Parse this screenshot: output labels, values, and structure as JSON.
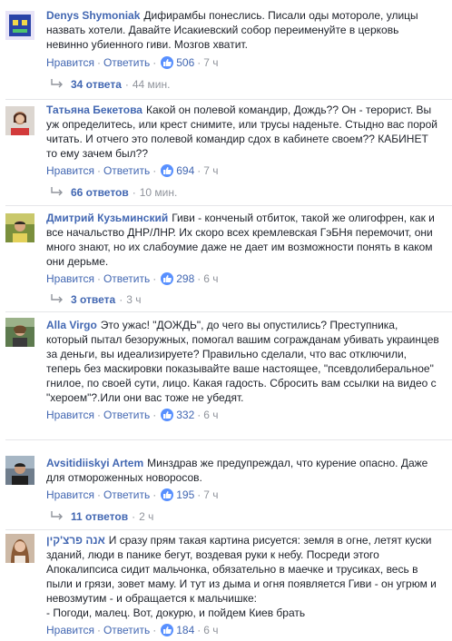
{
  "comments": [
    {
      "author": "Denys Shymoniak",
      "text": "Дифирамбы понеслись. Писали оды мотороле, улицы назвать хотели. Давайте Исакиевский собор переименуйте в церковь невинно убиенного гиви. Мозгов хватит.",
      "like_label": "Нравится",
      "reply_label": "Ответить",
      "like_count": "506",
      "time": "7 ч",
      "replies": "34 ответа",
      "replies_time": "44 мин."
    },
    {
      "author": "Татьяна Бекетова",
      "text": "Какой он полевой командир, Дождь?? Он - терорист. Вы уж определитесь, или крест снимите, или трусы наденьте. Стыдно вас порой читать. И отчего это полевой командир сдох в кабинете своем?? КАБИНЕТ то ему зачем был??",
      "like_label": "Нравится",
      "reply_label": "Ответить",
      "like_count": "694",
      "time": "7 ч",
      "replies": "66 ответов",
      "replies_time": "10 мин."
    },
    {
      "author": "Дмитрий Кузьминский",
      "text": "Гиви - конченый отбиток, такой же олигофрен, как и все начальство ДНР/ЛНР. Их скоро всех кремлевская ГэБНя перемочит, они много знают, но их слабоумие даже не дает им возможности понять в каком они дерьме.",
      "like_label": "Нравится",
      "reply_label": "Ответить",
      "like_count": "298",
      "time": "6 ч",
      "replies": "3 ответа",
      "replies_time": "3 ч"
    },
    {
      "author": "Alla Virgo",
      "text": "Это ужас! \"ДОЖДЬ\", до чего вы опустились? Преступника, который пытал безоружных, помогал вашим согражданам убивать украинцев за деньги, вы идеализируете? Правильно сделали, что вас отключили, теперь без маскировки показывайте ваше настоящее, \"псевдолиберальное\" гнилое, по своей сути, лицо. Какая гадость. Сбросить вам ссылки на видео с \"хероем\"?.Или они вас тоже не убедят.",
      "like_label": "Нравится",
      "reply_label": "Ответить",
      "like_count": "332",
      "time": "6 ч",
      "replies": "",
      "replies_time": ""
    },
    {
      "author": "Avsitidiiskyi Artem",
      "text": "Минздрав же предупреждал, что курение опасно. Даже для отмороженных новоросов.",
      "like_label": "Нравится",
      "reply_label": "Ответить",
      "like_count": "195",
      "time": "7 ч",
      "replies": "11 ответов",
      "replies_time": "2 ч"
    },
    {
      "author": "אנה פרצ'קין",
      "text": "И сразу прям такая картина рисуется: земля в огне, летят куски зданий, люди в панике бегут, воздевая руки к небу. Посреди этого Апокалипсиса сидит мальчонка, обязательно в маечке и трусиках, весь в пыли и грязи, зовет маму. И тут из дыма и огня появляется Гиви - он угрюм и невозмутим - и обращается к мальчишке:\n- Погоди, малец. Вот, докурю, и пойдем Киев брать",
      "like_label": "Нравится",
      "reply_label": "Ответить",
      "like_count": "184",
      "time": "6 ч",
      "replies": "",
      "replies_time": ""
    }
  ],
  "colors": {
    "link": "#4267b2",
    "meta": "#90949c",
    "like_badge": "#5890ff"
  }
}
